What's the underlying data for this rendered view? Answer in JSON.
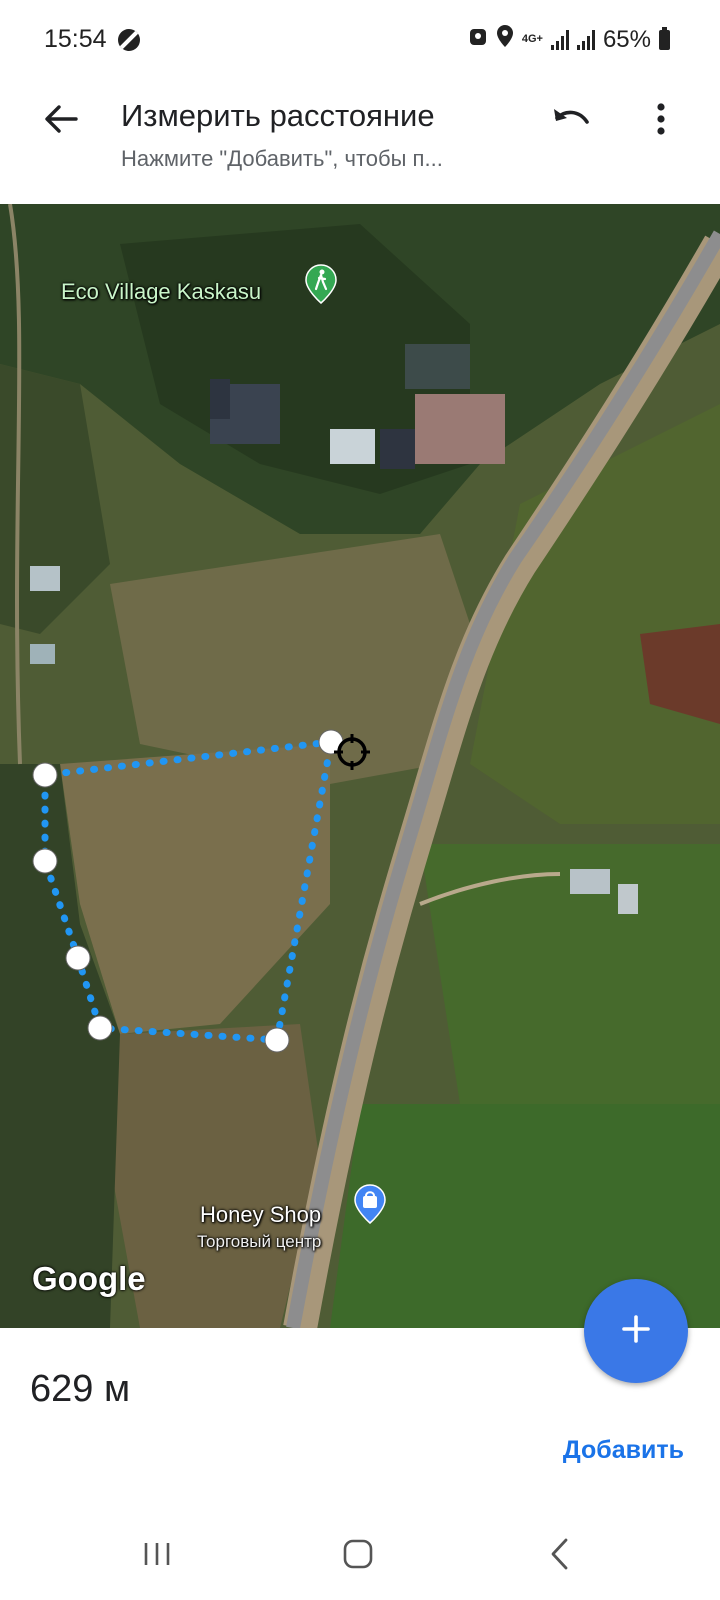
{
  "status_bar": {
    "time": "15:54",
    "network": "4G+",
    "battery": "65%",
    "icons": [
      "dnd-icon",
      "cloud-icon",
      "location-icon",
      "network-4g-icon",
      "signal-icon",
      "signal-icon",
      "battery-icon"
    ]
  },
  "header": {
    "title": "Измерить расстояние",
    "subtitle": "Нажмите \"Добавить\", чтобы п...",
    "icons": [
      "back-arrow-icon",
      "undo-icon",
      "more-vert-icon"
    ]
  },
  "map": {
    "place_labels": {
      "eco_village": "Eco Village Kaskasu",
      "honey_shop": "Honey Shop",
      "honey_shop_category": "Торговый центр"
    },
    "logo": "Google",
    "colors": {
      "measure_line": "#2196f3",
      "fab_blue": "#3a78e7",
      "link_blue": "#1a73e8"
    }
  },
  "bottom": {
    "distance": "629 м",
    "add_label": "Добавить"
  },
  "nav_bar": {
    "icons": [
      "recent-apps-icon",
      "home-icon",
      "back-icon"
    ]
  }
}
